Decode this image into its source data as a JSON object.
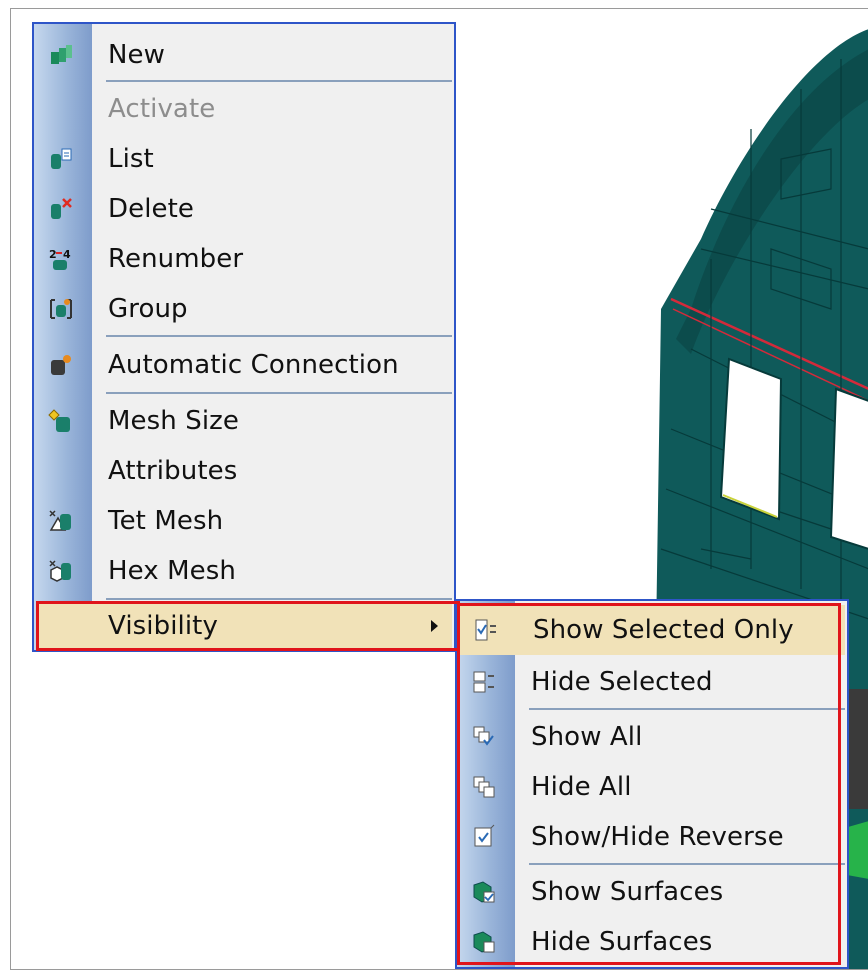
{
  "context_menu": {
    "items": [
      {
        "label": "New",
        "icon": "new-part-icon",
        "enabled": true
      },
      {
        "label": "Activate",
        "icon": "",
        "enabled": false
      },
      {
        "label": "List",
        "icon": "list-icon",
        "enabled": true
      },
      {
        "label": "Delete",
        "icon": "delete-icon",
        "enabled": true
      },
      {
        "label": "Renumber",
        "icon": "renumber-icon",
        "enabled": true
      },
      {
        "label": "Group",
        "icon": "group-icon",
        "enabled": true
      },
      {
        "label": "Automatic Connection",
        "icon": "automatic-connection-icon",
        "enabled": true
      },
      {
        "label": "Mesh Size",
        "icon": "mesh-size-icon",
        "enabled": true
      },
      {
        "label": "Attributes",
        "icon": "",
        "enabled": true
      },
      {
        "label": "Tet Mesh",
        "icon": "tet-mesh-icon",
        "enabled": true
      },
      {
        "label": "Hex Mesh",
        "icon": "hex-mesh-icon",
        "enabled": true
      },
      {
        "label": "Visibility",
        "icon": "",
        "enabled": true,
        "has_submenu": true,
        "highlighted": true
      }
    ]
  },
  "submenu": {
    "items": [
      {
        "label": "Show Selected Only",
        "icon": "show-selected-only-icon",
        "highlighted": true
      },
      {
        "label": "Hide Selected",
        "icon": "hide-selected-icon"
      },
      {
        "label": "Show All",
        "icon": "show-all-icon"
      },
      {
        "label": "Hide All",
        "icon": "hide-all-icon"
      },
      {
        "label": "Show/Hide Reverse",
        "icon": "show-hide-reverse-icon"
      },
      {
        "label": "Show Surfaces",
        "icon": "show-surfaces-icon"
      },
      {
        "label": "Hide Surfaces",
        "icon": "hide-surfaces-icon"
      }
    ]
  },
  "colors": {
    "menu_bg": "#f0f0f0",
    "gutter": "#9bb6da",
    "highlight": "#f1e2b8",
    "menu_border": "#2e55c8",
    "callout": "#e0141b",
    "model": "#0f5a5a"
  }
}
